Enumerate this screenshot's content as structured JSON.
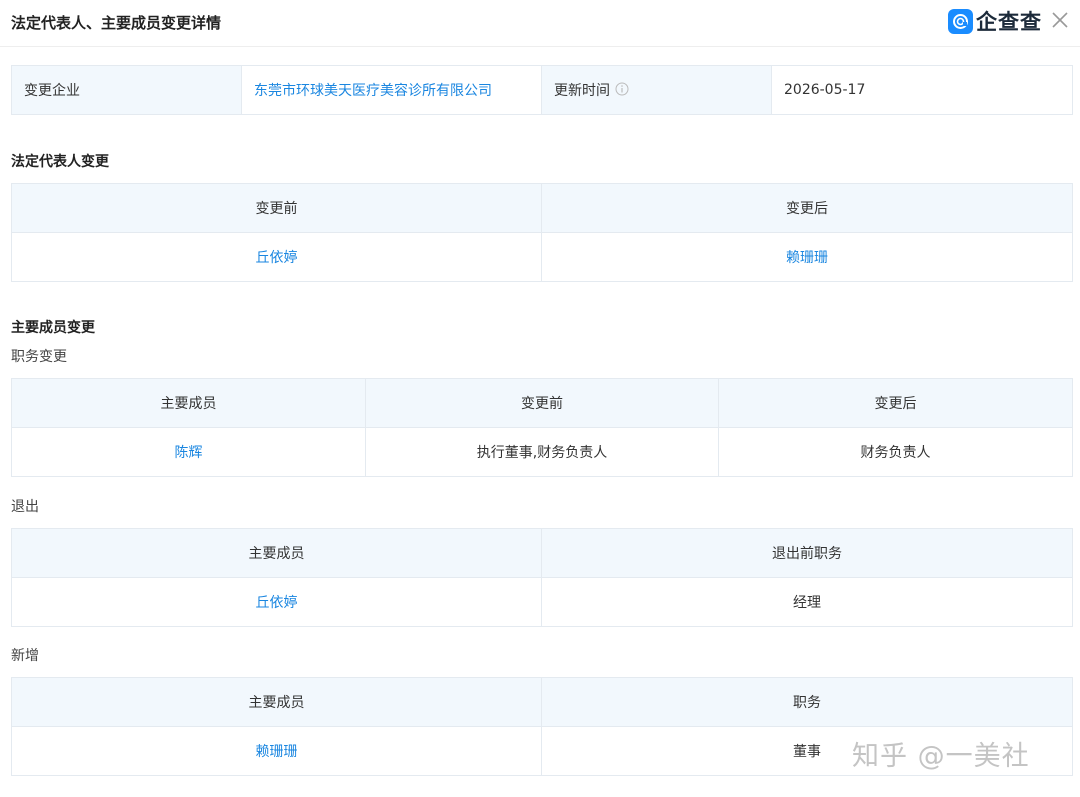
{
  "header": {
    "title": "法定代表人、主要成员变更详情",
    "brand": "企查查",
    "brand_color": "#1a8cff"
  },
  "info": {
    "company_label": "变更企业",
    "company_name": "东莞市环球美天医疗美容诊所有限公司",
    "update_label": "更新时间",
    "update_value": "2026-05-17"
  },
  "legal_rep": {
    "title": "法定代表人变更",
    "headers": [
      "变更前",
      "变更后"
    ],
    "before": "丘依婷",
    "after": "赖珊珊"
  },
  "members": {
    "title": "主要成员变更",
    "position_change": {
      "title": "职务变更",
      "headers": [
        "主要成员",
        "变更前",
        "变更后"
      ],
      "rows": [
        {
          "member": "陈辉",
          "before": "执行董事,财务负责人",
          "after": "财务负责人"
        }
      ]
    },
    "exit": {
      "title": "退出",
      "headers": [
        "主要成员",
        "退出前职务"
      ],
      "rows": [
        {
          "member": "丘依婷",
          "position": "经理"
        }
      ]
    },
    "added": {
      "title": "新增",
      "headers": [
        "主要成员",
        "职务"
      ],
      "rows": [
        {
          "member": "赖珊珊",
          "position": "董事"
        }
      ]
    }
  },
  "watermark": "知乎 @一美社",
  "colors": {
    "link": "#1a86e0",
    "header_bg": "#f2f8fd",
    "border": "#e4eaf0"
  }
}
